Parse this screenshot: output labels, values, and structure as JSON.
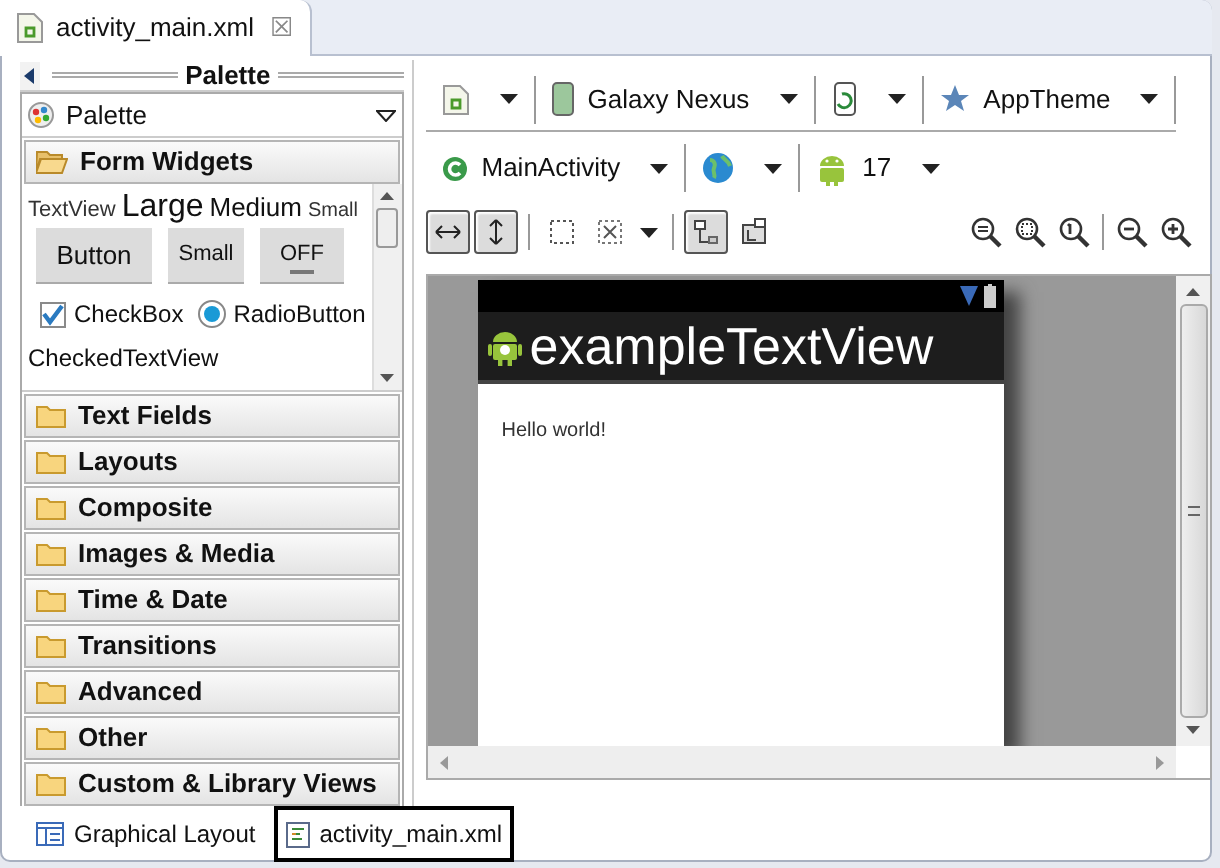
{
  "editor_tab": {
    "title": "activity_main.xml",
    "close": "☒"
  },
  "palette": {
    "header": "Palette",
    "dropdown": "Palette",
    "open_category": {
      "label": "Form Widgets",
      "expanded": true
    },
    "text_samples": [
      {
        "label": "TextView",
        "kind": "textview"
      },
      {
        "label": "Large",
        "kind": "large"
      },
      {
        "label": "Medium",
        "kind": "medium"
      },
      {
        "label": "Small",
        "kind": "small"
      }
    ],
    "buttons": [
      {
        "label": "Button",
        "kind": "button"
      },
      {
        "label": "Small",
        "kind": "small"
      },
      {
        "label": "OFF",
        "kind": "toggle"
      }
    ],
    "checkbox": {
      "label": "CheckBox",
      "checked": true
    },
    "radio": {
      "label": "RadioButton",
      "selected": true
    },
    "checked_text_view": "CheckedTextView",
    "categories": [
      {
        "label": "Text Fields",
        "expanded": false
      },
      {
        "label": "Layouts",
        "expanded": false
      },
      {
        "label": "Composite",
        "expanded": false
      },
      {
        "label": "Images & Media",
        "expanded": false
      },
      {
        "label": "Time & Date",
        "expanded": false
      },
      {
        "label": "Transitions",
        "expanded": false
      },
      {
        "label": "Advanced",
        "expanded": false
      },
      {
        "label": "Other",
        "expanded": false
      },
      {
        "label": "Custom & Library Views",
        "expanded": false
      }
    ]
  },
  "toolbar": {
    "row_1": [
      {
        "kind": "config"
      },
      {
        "kind": "device",
        "label": "Galaxy Nexus"
      },
      {
        "kind": "orientation"
      },
      {
        "kind": "theme",
        "label": "AppTheme"
      }
    ],
    "row_2": [
      {
        "kind": "activity",
        "label": "MainActivity"
      },
      {
        "kind": "locale"
      },
      {
        "kind": "api",
        "label": "17"
      }
    ],
    "view_toggles": [
      {
        "kind": "fit-width",
        "selected": true
      },
      {
        "kind": "fit-height",
        "selected": true
      }
    ],
    "clip_toggles": [
      {
        "kind": "outline",
        "selected": false
      },
      {
        "kind": "expand",
        "selected": false
      }
    ],
    "layout_toggles": [
      {
        "kind": "layout-one",
        "selected": true
      },
      {
        "kind": "layout-two",
        "selected": false
      }
    ]
  },
  "preview": {
    "app_title": "exampleTextView",
    "content": "Hello world!"
  },
  "bottom_tabs": [
    {
      "label": "Graphical Layout",
      "kind": "graphical",
      "selected": false
    },
    {
      "label": "activity_main.xml",
      "kind": "xml",
      "selected": true
    }
  ]
}
